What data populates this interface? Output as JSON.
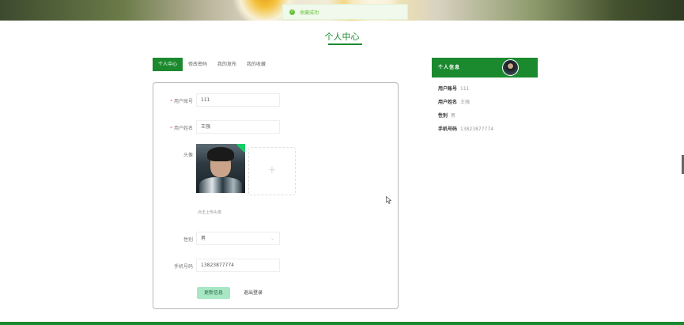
{
  "toast": {
    "message": "收藏成功",
    "icon": "success-check-icon"
  },
  "page": {
    "title": "个人中心"
  },
  "tabs": [
    {
      "label": "个人中心",
      "active": true
    },
    {
      "label": "修改密码",
      "active": false
    },
    {
      "label": "我的发布",
      "active": false
    },
    {
      "label": "我的收藏",
      "active": false
    }
  ],
  "form": {
    "account": {
      "label": "用户账号",
      "required": "*",
      "value": "111"
    },
    "name": {
      "label": "用户姓名",
      "required": "*",
      "value": "王强"
    },
    "avatar": {
      "label": "头像",
      "hint": "点击上传头像",
      "add_icon": "+"
    },
    "gender": {
      "label": "性别",
      "value": "男"
    },
    "phone": {
      "label": "手机号码",
      "value": "13823877774"
    },
    "update_button": "更新信息",
    "logout_button": "退出登录"
  },
  "info": {
    "title": "个人信息",
    "rows": [
      {
        "key": "用户账号",
        "value": "111"
      },
      {
        "key": "用户姓名",
        "value": "王强"
      },
      {
        "key": "性别",
        "value": "男"
      },
      {
        "key": "手机号码",
        "value": "13823877774"
      }
    ]
  },
  "colors": {
    "primary": "#1b8a2e",
    "success": "#67c23a",
    "button_light": "#a7e7c5"
  }
}
